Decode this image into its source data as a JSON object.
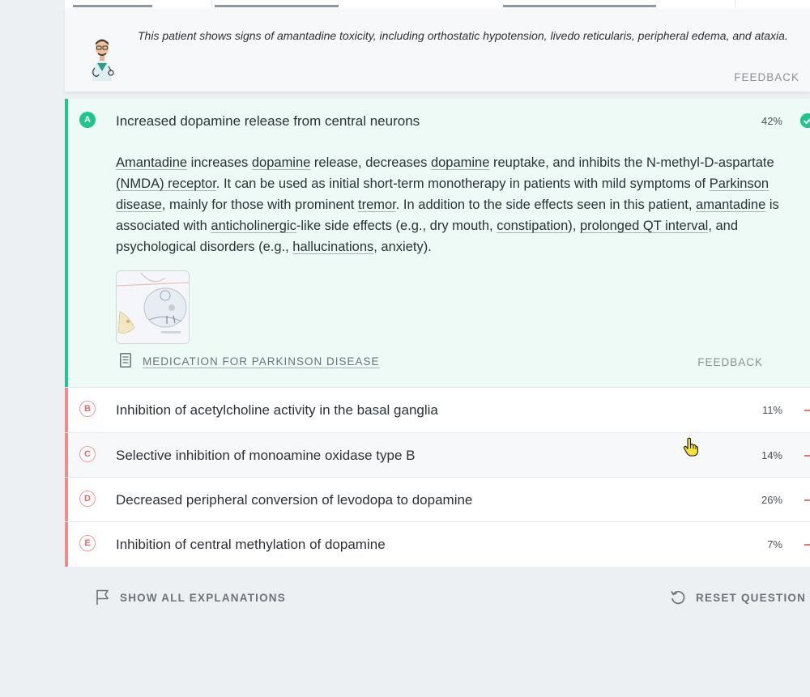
{
  "hint": {
    "text": "This patient shows signs of amantadine toxicity, including orthostatic hypotension, livedo reticularis, peripheral edema, and ataxia.",
    "feedback_label": "FEEDBACK"
  },
  "answers": [
    {
      "letter": "A",
      "text": "Increased dopamine release from central neurons",
      "percent": "42%",
      "status": "correct",
      "explanation": [
        {
          "t": "Amantadine",
          "link": true
        },
        {
          "t": " increases "
        },
        {
          "t": "dopamine",
          "link": true
        },
        {
          "t": " release, decreases "
        },
        {
          "t": "dopamine",
          "link": true
        },
        {
          "t": " reuptake, and inhibits the N-methyl-D-aspartate "
        },
        {
          "t": "(NMDA) receptor",
          "link": true
        },
        {
          "t": ". It can be used as initial short-term monotherapy in patients with mild symptoms of "
        },
        {
          "t": "Parkinson disease",
          "link": true
        },
        {
          "t": ", mainly for those with prominent "
        },
        {
          "t": "tremor",
          "link": true
        },
        {
          "t": ". In addition to the side effects seen in this patient, "
        },
        {
          "t": "amantadine",
          "link": true
        },
        {
          "t": " is associated with "
        },
        {
          "t": "anticholinergic",
          "link": true
        },
        {
          "t": "-like side effects (e.g., dry mouth, "
        },
        {
          "t": "constipation",
          "link": true
        },
        {
          "t": "), "
        },
        {
          "t": "prolonged QT interval",
          "link": true
        },
        {
          "t": ", and psychological disorders (e.g., "
        },
        {
          "t": "hallucinations",
          "link": true
        },
        {
          "t": ", anxiety)."
        }
      ],
      "article_link": "MEDICATION FOR PARKINSON DISEASE",
      "feedback_label": "FEEDBACK"
    },
    {
      "letter": "B",
      "text": "Inhibition of acetylcholine activity in the basal ganglia",
      "percent": "11%",
      "status": "wrong"
    },
    {
      "letter": "C",
      "text": "Selective inhibition of monoamine oxidase type B",
      "percent": "14%",
      "status": "wrong"
    },
    {
      "letter": "D",
      "text": "Decreased peripheral conversion of levodopa to dopamine",
      "percent": "26%",
      "status": "wrong"
    },
    {
      "letter": "E",
      "text": "Inhibition of central methylation of dopamine",
      "percent": "7%",
      "status": "wrong"
    }
  ],
  "footer": {
    "show_all_label": "SHOW ALL EXPLANATIONS",
    "reset_label": "RESET QUESTION"
  },
  "colors": {
    "correct": "#20c48e",
    "wrong": "#ee8c8c",
    "muted_text": "#8a9199"
  },
  "icons": {
    "avatar": "doctor-avatar-icon",
    "check": "check-circle-icon",
    "article": "document-icon",
    "flag": "flag-icon",
    "reset": "reset-icon"
  }
}
